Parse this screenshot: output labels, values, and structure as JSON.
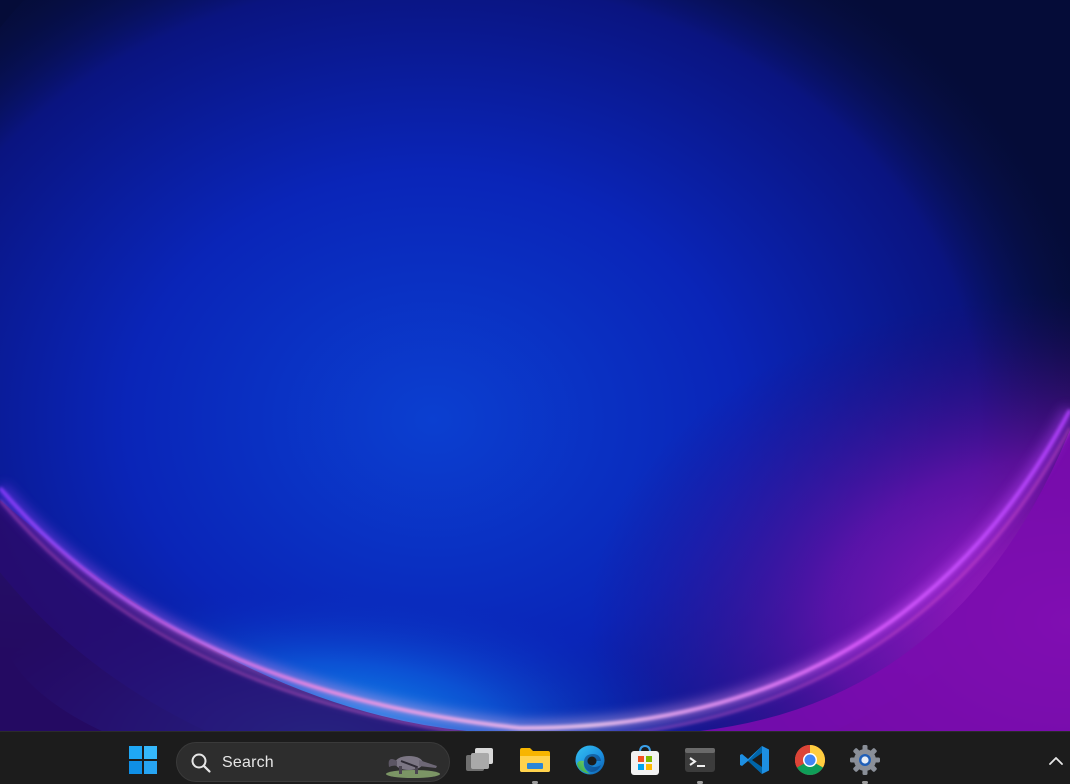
{
  "desktop": {
    "wallpaper": "windows-11-bloom-blue",
    "colors": {
      "base": "#061040",
      "glow_blue": "#1a8cff",
      "glow_pink": "#ff7ad9",
      "glow_purple": "#b020e0"
    }
  },
  "taskbar": {
    "background": "#1c1c1c",
    "start_icon": "windows-logo-icon",
    "search": {
      "label": "Search",
      "icon": "search-icon",
      "highlight_icon": "anteater-icon"
    },
    "apps": [
      {
        "name": "task-view",
        "icon": "task-view-icon",
        "running": false
      },
      {
        "name": "file-explorer",
        "icon": "folder-icon",
        "running": true
      },
      {
        "name": "edge",
        "icon": "edge-icon",
        "running": false
      },
      {
        "name": "microsoft-store",
        "icon": "store-icon",
        "running": false
      },
      {
        "name": "terminal",
        "icon": "terminal-icon",
        "running": true
      },
      {
        "name": "vscode",
        "icon": "vscode-icon",
        "running": false
      },
      {
        "name": "chrome",
        "icon": "chrome-icon",
        "running": false
      },
      {
        "name": "settings",
        "icon": "gear-icon",
        "running": true
      }
    ],
    "tray": {
      "overflow_icon": "chevron-up-icon"
    }
  }
}
